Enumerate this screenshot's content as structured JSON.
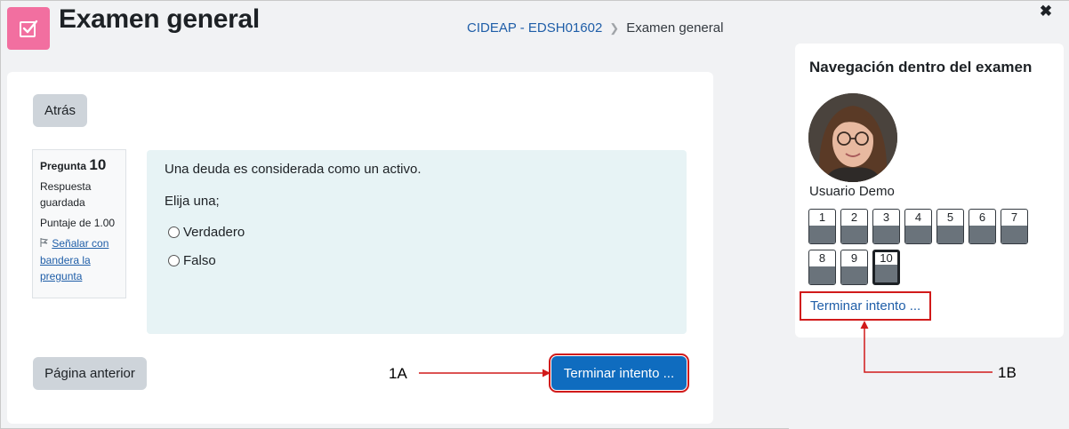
{
  "header": {
    "title": "Examen general",
    "breadcrumb": {
      "course": "CIDEAP - EDSH01602",
      "current": "Examen general"
    }
  },
  "main": {
    "back_label": "Atrás",
    "question_info": {
      "label": "Pregunta",
      "number": "10",
      "status": "Respuesta guardada",
      "score": "Puntaje de 1.00",
      "flag_label": "Señalar con bandera la pregunta"
    },
    "question": {
      "text": "Una deuda es considerada como un activo.",
      "prompt": "Elija una;",
      "options": [
        "Verdadero",
        "Falso"
      ]
    },
    "prev_page_label": "Página anterior",
    "finish_label": "Terminar intento ..."
  },
  "drawer": {
    "title": "Navegación dentro del examen",
    "user_name": "Usuario Demo",
    "questions": [
      "1",
      "2",
      "3",
      "4",
      "5",
      "6",
      "7",
      "8",
      "9",
      "10"
    ],
    "current_question": "10",
    "finish_label": "Terminar intento ..."
  },
  "annotations": {
    "a": "1A",
    "b": "1B"
  },
  "colors": {
    "accent": "#0f6cbf",
    "header_icon": "#f26fa0",
    "highlight": "#d11a1a",
    "question_bg": "#e7f3f5"
  },
  "icons": {
    "header": "quiz-icon",
    "close": "close-icon",
    "flag": "flag-icon"
  }
}
